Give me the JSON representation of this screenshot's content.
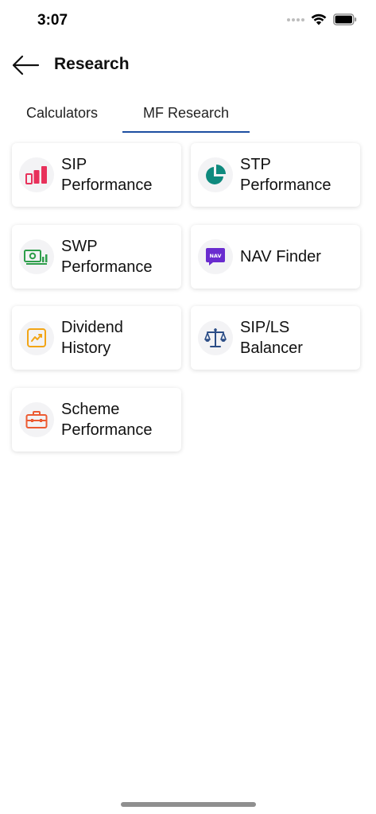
{
  "status": {
    "time": "3:07"
  },
  "header": {
    "title": "Research"
  },
  "tabs": [
    {
      "label": "Calculators",
      "active": false
    },
    {
      "label": "MF Research",
      "active": true
    }
  ],
  "colors": {
    "accent": "#1d4ea1"
  },
  "cards": [
    {
      "label": "SIP\nPerformance",
      "icon": "bar-chart-icon",
      "color": "#e8315b"
    },
    {
      "label": "STP\nPerformance",
      "icon": "pie-chart-icon",
      "color": "#0f8a7e"
    },
    {
      "label": "SWP\nPerformance",
      "icon": "cash-chart-icon",
      "color": "#2e9e4b"
    },
    {
      "label": "NAV Finder",
      "icon": "nav-icon",
      "icon_text": "NAV",
      "color": "#6a2ccf"
    },
    {
      "label": "Dividend\nHistory",
      "icon": "trend-icon",
      "color": "#f2a516"
    },
    {
      "label": "SIP/LS\nBalancer",
      "icon": "scale-icon",
      "color": "#2b4d86"
    },
    {
      "label": "Scheme\nPerformance",
      "icon": "briefcase-icon",
      "color": "#ec5b33"
    }
  ]
}
